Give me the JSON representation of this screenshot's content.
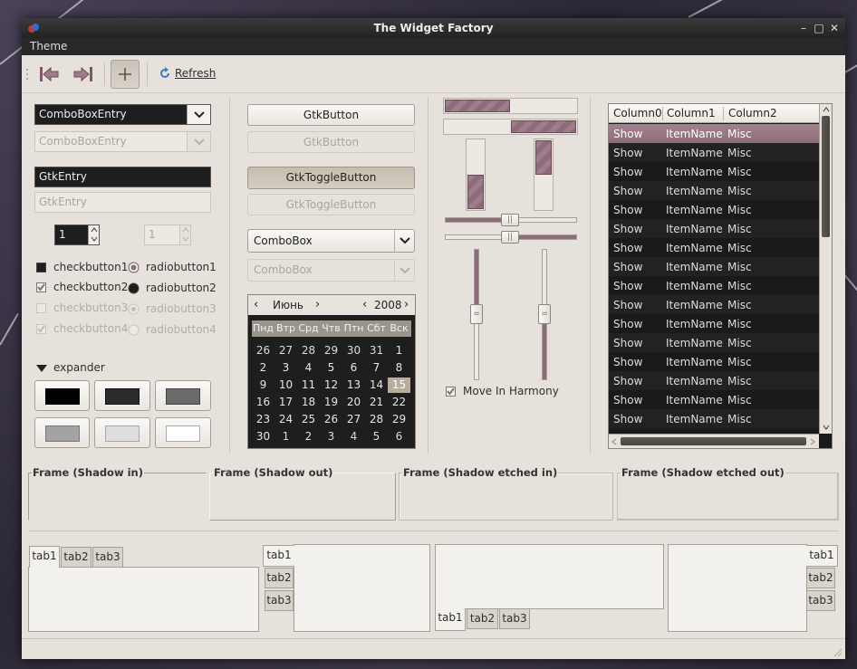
{
  "window": {
    "title": "The Widget Factory"
  },
  "menu": {
    "theme": "Theme"
  },
  "toolbar": {
    "refresh": "Refresh"
  },
  "col1": {
    "combo_entry": "ComboBoxEntry",
    "combo_entry_dis": "ComboBoxEntry",
    "entry": "GtkEntry",
    "entry_dis": "GtkEntry",
    "spin1": "1",
    "spin2": "1",
    "check1": "checkbutton1",
    "check2": "checkbutton2",
    "check3": "checkbutton3",
    "check4": "checkbutton4",
    "radio1": "radiobutton1",
    "radio2": "radiobutton2",
    "radio3": "radiobutton3",
    "radio4": "radiobutton4",
    "expander": "expander"
  },
  "col2": {
    "button": "GtkButton",
    "button_dis": "GtkButton",
    "toggle": "GtkToggleButton",
    "toggle_dis": "GtkToggleButton",
    "combo": "ComboBox",
    "combo_dis": "ComboBox"
  },
  "calendar": {
    "month": "Июнь",
    "year": "2008",
    "daynames": [
      "Пнд",
      "Втр",
      "Срд",
      "Чтв",
      "Птн",
      "Сбт",
      "Вск"
    ],
    "weeks": [
      [
        "26",
        "27",
        "28",
        "29",
        "30",
        "31",
        "1"
      ],
      [
        "2",
        "3",
        "4",
        "5",
        "6",
        "7",
        "8"
      ],
      [
        "9",
        "10",
        "11",
        "12",
        "13",
        "14",
        "15"
      ],
      [
        "16",
        "17",
        "18",
        "19",
        "20",
        "21",
        "22"
      ],
      [
        "23",
        "24",
        "25",
        "26",
        "27",
        "28",
        "29"
      ],
      [
        "30",
        "1",
        "2",
        "3",
        "4",
        "5",
        "6"
      ]
    ],
    "selected": "15"
  },
  "col3": {
    "move_harmony": "Move In Harmony"
  },
  "tree": {
    "headers": [
      "Column0",
      "Column1",
      "Column2"
    ],
    "rows": [
      [
        "Show",
        "ItemName",
        "Misc"
      ],
      [
        "Show",
        "ItemName",
        "Misc"
      ],
      [
        "Show",
        "ItemName",
        "Misc"
      ],
      [
        "Show",
        "ItemName",
        "Misc"
      ],
      [
        "Show",
        "ItemName",
        "Misc"
      ],
      [
        "Show",
        "ItemName",
        "Misc"
      ],
      [
        "Show",
        "ItemName",
        "Misc"
      ],
      [
        "Show",
        "ItemName",
        "Misc"
      ],
      [
        "Show",
        "ItemName",
        "Misc"
      ],
      [
        "Show",
        "ItemName",
        "Misc"
      ],
      [
        "Show",
        "ItemName",
        "Misc"
      ],
      [
        "Show",
        "ItemName",
        "Misc"
      ],
      [
        "Show",
        "ItemName",
        "Misc"
      ],
      [
        "Show",
        "ItemName",
        "Misc"
      ],
      [
        "Show",
        "ItemName",
        "Misc"
      ],
      [
        "Show",
        "ItemName",
        "Misc"
      ]
    ]
  },
  "frames": {
    "f1": "Frame (Shadow in)",
    "f2": "Frame (Shadow out)",
    "f3": "Frame (Shadow etched in)",
    "f4": "Frame (Shadow etched out)"
  },
  "tabs": {
    "t1": "tab1",
    "t2": "tab2",
    "t3": "tab3"
  },
  "colors": {
    "accent": "#8d6c7a",
    "dark": "#1e1e1e",
    "bg": "#e6e2db"
  }
}
